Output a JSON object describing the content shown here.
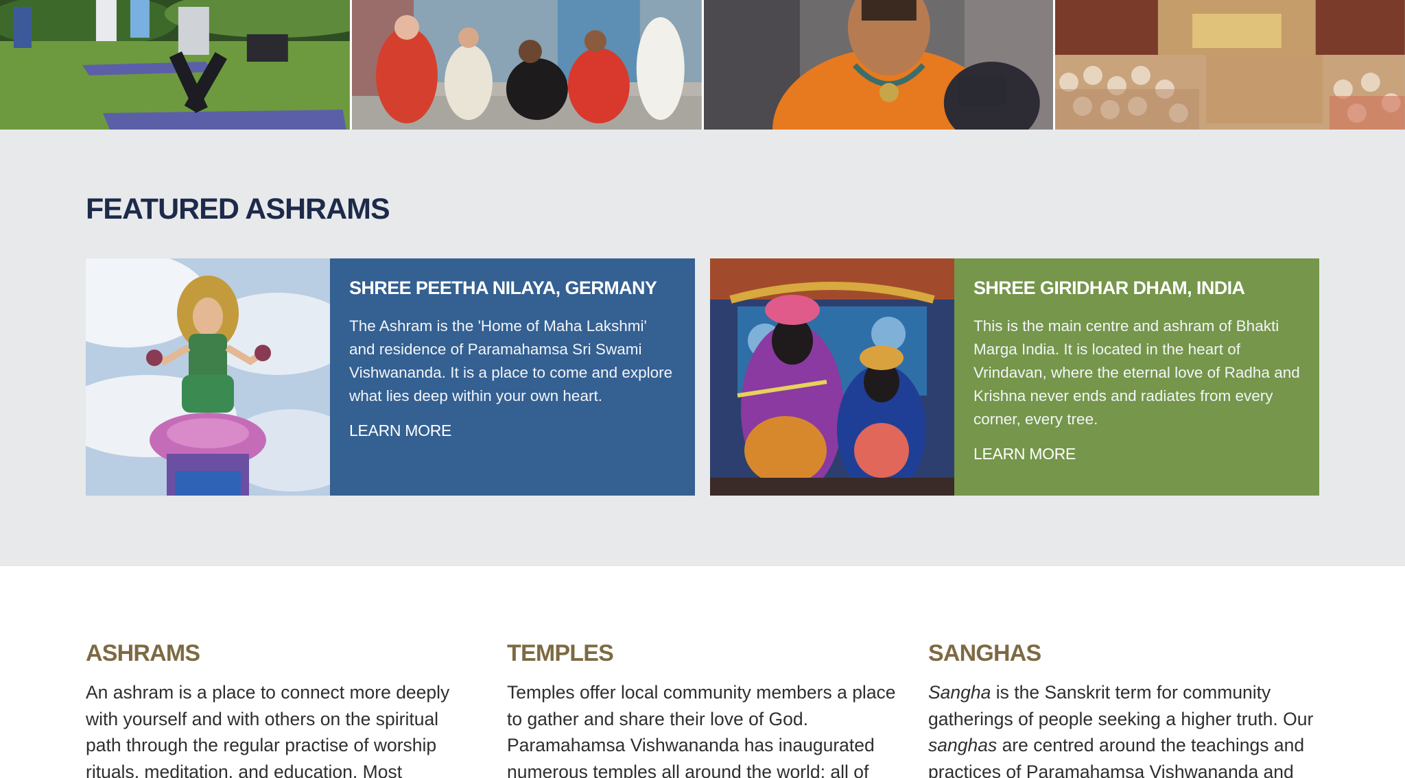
{
  "photo_strip": {
    "images": [
      {
        "name": "outdoor-yoga-photo"
      },
      {
        "name": "group-celebration-photo"
      },
      {
        "name": "swami-portrait-photo"
      },
      {
        "name": "temple-gathering-photo"
      }
    ]
  },
  "featured": {
    "heading": "FEATURED ASHRAMS",
    "cards": [
      {
        "title": "SHREE PEETHA NILAYA, GERMANY",
        "text": "The Ashram is the 'Home of Maha Lakshmi' and residence of Paramahamsa Sri Swami Vishwananda. It is a place to come and explore what lies deep within your own heart.",
        "link": "LEARN MORE",
        "color": "#346092"
      },
      {
        "title": "SHREE GIRIDHAR DHAM, INDIA",
        "text": "This is the main centre and ashram of Bhakti Marga India. It is located in the heart of Vrindavan, where the eternal love of Radha and Krishna never ends and radiates from every corner, every tree.",
        "link": "LEARN MORE",
        "color": "#75964b"
      }
    ]
  },
  "info": {
    "ashrams": {
      "title": "ASHRAMS",
      "text": "An ashram is a place to connect more deeply with yourself and with others on the spiritual path through the regular practise of worship rituals, meditation, and education. Most ashrams"
    },
    "temples": {
      "title": "TEMPLES",
      "text": "Temples offer local community members a place to gather and share their love of God. Paramahamsa Vishwananda has inaugurated numerous temples all around the world; all of"
    },
    "sanghas": {
      "title": "SANGHAS",
      "term": "Sangha",
      "text_1": " is the Sanskrit term for community gatherings of people seeking a higher truth. Our ",
      "term_plural": "sanghas",
      "text_2": " are centred around the teachings and practices of Paramahamsa Vishwananda and His"
    }
  },
  "colors": {
    "heading": "#1d2a4a",
    "section_bg": "#e8e9eb",
    "column_heading": "#7d6a43"
  }
}
